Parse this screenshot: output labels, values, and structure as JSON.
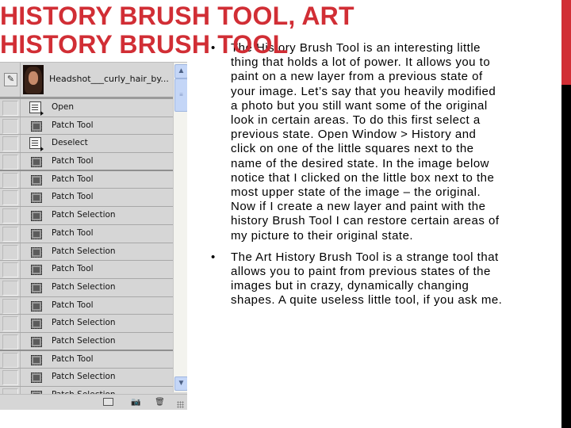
{
  "slide": {
    "title_line1": "HISTORY BRUSH TOOL, ART",
    "title_line2": "HISTORY BRUSH TOOL",
    "accent_color": "#d12e35",
    "bullets": [
      {
        "marker": "•",
        "text": "The History Brush Tool is an interesting little thing that holds a lot of power. It allows you to paint on a new layer from a previous state of your image. Let’s say that you heavily modified a photo but you still want some of the original look in certain areas. To do this first select a previous state. Open Window > History and click on one of the little squares next to the name of the desired state. In the image below notice that I clicked on the little box next to the most upper state of the image – the original. Now if I create a new layer and paint with the history Brush Tool I can restore certain areas of my picture to their original state."
      },
      {
        "marker": "•",
        "text": "The Art History Brush Tool is a strange tool that allows you to paint from previous states of the images but in crazy, dynamically changing shapes. A quite useless little tool, if you ask me."
      }
    ]
  },
  "history_panel": {
    "snapshot": {
      "name": "Headshot___curly_hair_by...",
      "brush_icon": "history-brush-icon"
    },
    "states": [
      {
        "label": "Open",
        "icon": "document-icon"
      },
      {
        "label": "Patch Tool",
        "icon": "patch-icon"
      },
      {
        "label": "Deselect",
        "icon": "document-icon"
      },
      {
        "label": "Patch Tool",
        "icon": "patch-icon"
      },
      {
        "label": "Patch Tool",
        "icon": "patch-icon"
      },
      {
        "label": "Patch Tool",
        "icon": "patch-icon"
      },
      {
        "label": "Patch Selection",
        "icon": "patch-icon"
      },
      {
        "label": "Patch Tool",
        "icon": "patch-icon"
      },
      {
        "label": "Patch Selection",
        "icon": "patch-icon"
      },
      {
        "label": "Patch Tool",
        "icon": "patch-icon"
      },
      {
        "label": "Patch Selection",
        "icon": "patch-icon"
      },
      {
        "label": "Patch Tool",
        "icon": "patch-icon"
      },
      {
        "label": "Patch Selection",
        "icon": "patch-icon"
      },
      {
        "label": "Patch Selection",
        "icon": "patch-icon"
      },
      {
        "label": "Patch Tool",
        "icon": "patch-icon"
      },
      {
        "label": "Patch Selection",
        "icon": "patch-icon"
      },
      {
        "label": "Patch Selection",
        "icon": "patch-icon"
      }
    ],
    "scroll_up_glyph": "▲",
    "scroll_down_glyph": "▼",
    "scroll_thumb_glyph": "≡",
    "footer_buttons": [
      {
        "name": "new-document-from-state",
        "glyph": ""
      },
      {
        "name": "create-snapshot",
        "glyph": "📷"
      },
      {
        "name": "delete-state",
        "glyph": "🗑"
      }
    ]
  }
}
